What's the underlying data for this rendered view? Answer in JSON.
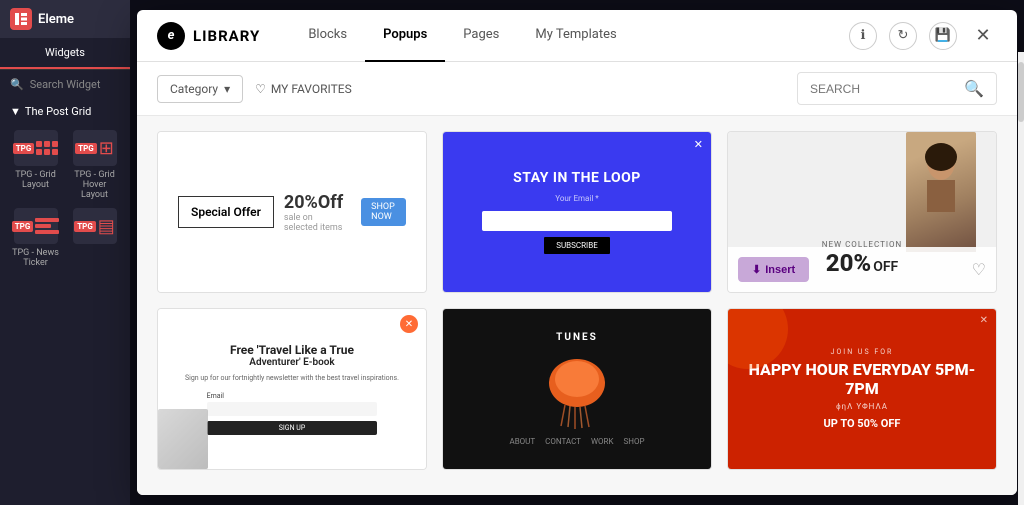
{
  "sidebar": {
    "title": "Eleme",
    "icon_letter": "E",
    "tabs": [
      {
        "label": "Widgets",
        "active": true
      }
    ],
    "search_placeholder": "Search Widget",
    "section_title": "The Post Grid",
    "widgets": [
      {
        "label": "TPG - Grid Layout",
        "type": "grid"
      },
      {
        "label": "TPG - Grid Hover Layout",
        "type": "hover"
      },
      {
        "label": "TPG - News Ticker",
        "type": "ticker"
      },
      {
        "label": "",
        "type": "stack"
      }
    ]
  },
  "modal": {
    "library_label": "LIBRARY",
    "nav_tabs": [
      {
        "label": "Blocks",
        "active": false
      },
      {
        "label": "Popups",
        "active": true
      },
      {
        "label": "Pages",
        "active": false
      },
      {
        "label": "My Templates",
        "active": false
      }
    ],
    "header_icons": [
      "info-icon",
      "refresh-icon",
      "save-icon",
      "close-icon"
    ],
    "filter": {
      "category_label": "Category",
      "favorites_label": "MY FAVORITES",
      "search_placeholder": "SEARCH"
    },
    "templates": [
      {
        "id": 1,
        "type": "special-offer",
        "badge": "Special Offer",
        "discount": "20%Off",
        "has_overlay": false
      },
      {
        "id": 2,
        "type": "stay-in-loop",
        "title": "STAY IN THE LOOP",
        "subtitle": "Your Email *",
        "subscribe_label": "SUBSCRIBE",
        "has_overlay": false
      },
      {
        "id": 3,
        "type": "20-off",
        "small_text": "NEW COLLECTION",
        "big_text": "20%",
        "off_text": "OFF",
        "has_overlay": true,
        "insert_label": "Insert",
        "favorite": false
      },
      {
        "id": 4,
        "type": "travel",
        "title_line1": "Free 'Travel Like a True",
        "title_line2": "Adventurer' E-book",
        "desc": "Sign up for our fortnightly newsletter with the best travel inspirations.",
        "email_label": "Email",
        "btn_label": "SIGN UP",
        "has_overlay": false
      },
      {
        "id": 5,
        "type": "jellyfish",
        "logo": "TUNES",
        "has_overlay": false
      },
      {
        "id": 6,
        "type": "happy-hour",
        "small": "JOIN US FOR",
        "title": "HAPPY HOUR EVERYDAY 5PM-7PM",
        "symbols": "ϕηΛ ΥΦΗΛΑ",
        "discount": "UP TO 50% OFF",
        "has_overlay": false
      }
    ]
  }
}
